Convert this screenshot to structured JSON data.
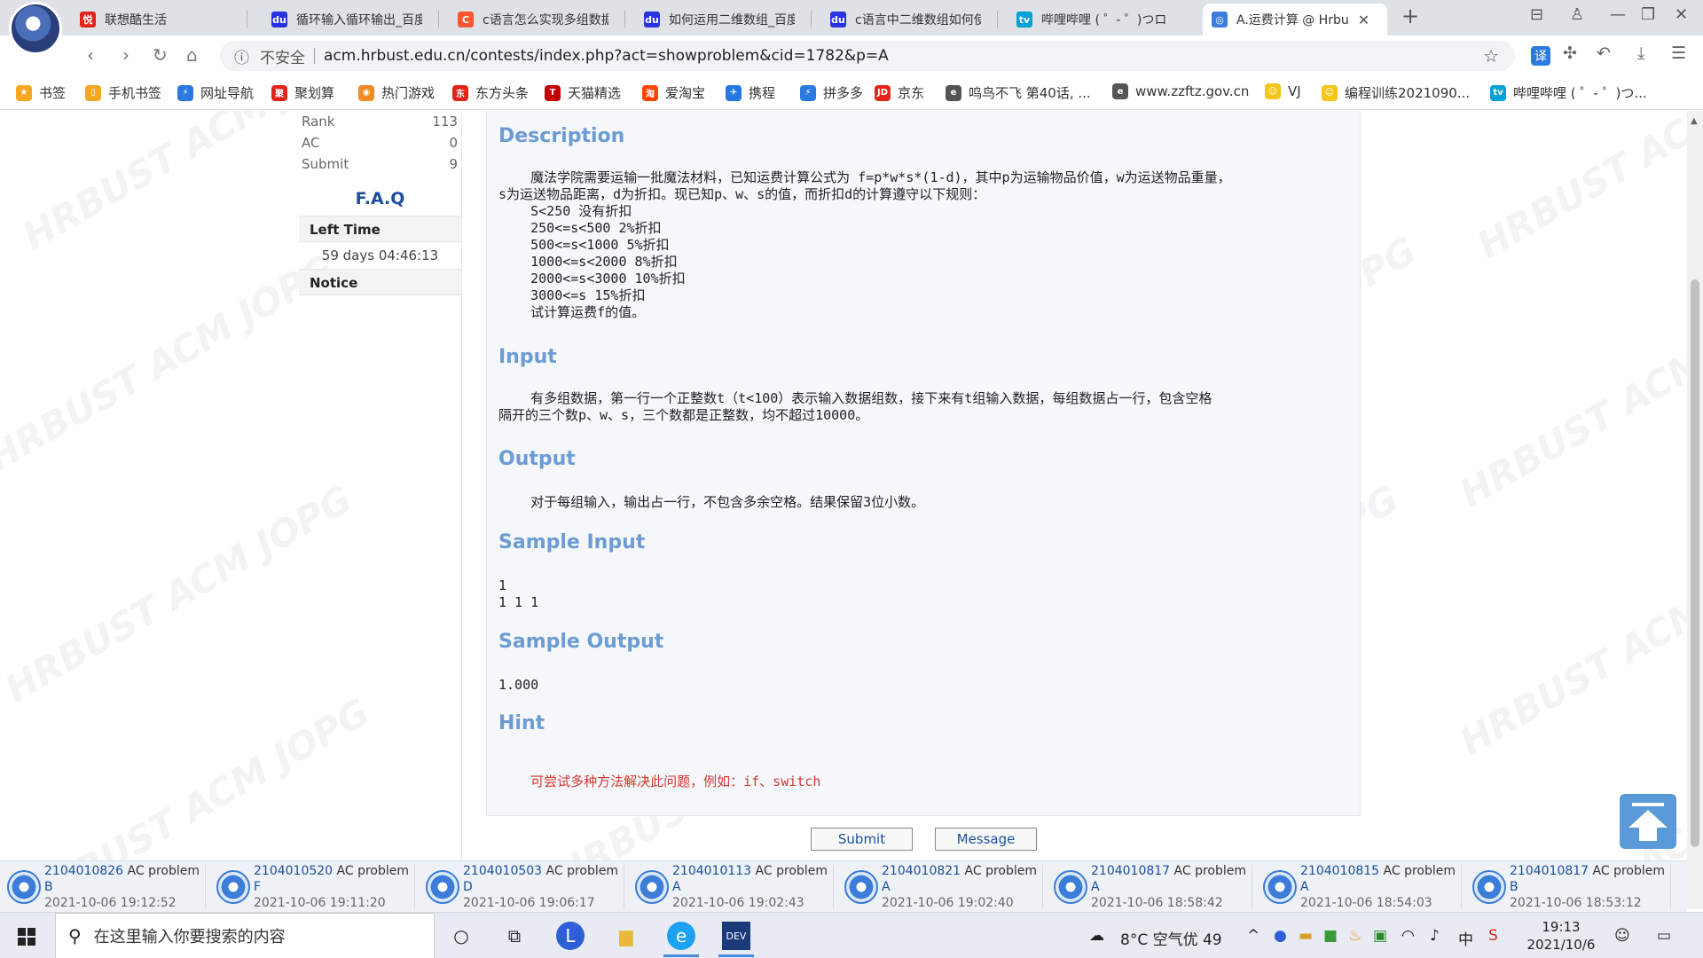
{
  "browser": {
    "tabs": [
      {
        "label": "联想酷生活",
        "fav_color": "#e2231a",
        "fav_glyph": "悦"
      },
      {
        "label": "循环输入循环输出_百度",
        "fav_color": "#2932e1",
        "fav_glyph": "du"
      },
      {
        "label": "c语言怎么实现多组数据",
        "fav_color": "#fc5531",
        "fav_glyph": "C"
      },
      {
        "label": "如何运用二维数组_百度",
        "fav_color": "#2932e1",
        "fav_glyph": "du"
      },
      {
        "label": "c语言中二维数组如何使",
        "fav_color": "#2932e1",
        "fav_glyph": "du"
      },
      {
        "label": "哔哩哔哩 ( ゜- ゜)つロ 干",
        "fav_color": "#00a1d6",
        "fav_glyph": "tv"
      },
      {
        "label": "A.运费计算 @ Hrbu",
        "fav_color": "#3b7dd8",
        "fav_glyph": "◎",
        "active": true
      }
    ],
    "address": {
      "insecure_label": "不安全",
      "url": "acm.hrbust.edu.cn/contests/index.php?act=showproblem&cid=1782&p=A"
    },
    "bookmarks": [
      {
        "label": "书签",
        "color": "#f5a623",
        "glyph": "★"
      },
      {
        "label": "手机书签",
        "color": "#f5a623",
        "glyph": "▯"
      },
      {
        "label": "网址导航",
        "color": "#2a7ae2",
        "glyph": "⚡"
      },
      {
        "label": "聚划算",
        "color": "#e2231a",
        "glyph": "聚"
      },
      {
        "label": "热门游戏",
        "color": "#f08a24",
        "glyph": "◉"
      },
      {
        "label": "东方头条",
        "color": "#e2231a",
        "glyph": "东"
      },
      {
        "label": "天猫精选",
        "color": "#c40000",
        "glyph": "T"
      },
      {
        "label": "爱淘宝",
        "color": "#ff4400",
        "glyph": "淘"
      },
      {
        "label": "携程",
        "color": "#2577e3",
        "glyph": "✈"
      },
      {
        "label": "拼多多",
        "color": "#2a7ae2",
        "glyph": "⚡"
      },
      {
        "label": "京东",
        "color": "#e1251b",
        "glyph": "JD"
      },
      {
        "label": "鸣鸟不飞 第40话, ...",
        "color": "#555555",
        "glyph": "e"
      },
      {
        "label": "www.zzftz.gov.cn",
        "color": "#555555",
        "glyph": "e"
      },
      {
        "label": "VJ",
        "color": "#f5c518",
        "glyph": "☺"
      },
      {
        "label": "编程训练2021090...",
        "color": "#f5c518",
        "glyph": "☺"
      },
      {
        "label": "哔哩哔哩 ( ゜- ゜)つ...",
        "color": "#00a1d6",
        "glyph": "tv"
      }
    ]
  },
  "sidebar": {
    "stats": [
      {
        "label": "Rank",
        "value": "113"
      },
      {
        "label": "AC",
        "value": "0"
      },
      {
        "label": "Submit",
        "value": "9"
      }
    ],
    "faq": "F.A.Q",
    "left_time_label": "Left Time",
    "left_time_value": "59 days 04:46:13",
    "notice_label": "Notice"
  },
  "problem": {
    "description_title": "Description",
    "description_body": "    魔法学院需要运输一批魔法材料，已知运费计算公式为 f=p*w*s*(1-d)，其中p为运输物品价值，w为运送物品重量，\ns为运送物品距离，d为折扣。现已知p、w、s的值，而折扣d的计算遵守以下规则：\n    S<250 没有折扣\n    250<=s<500 2%折扣\n    500<=s<1000 5%折扣\n    1000<=s<2000 8%折扣\n    2000<=s<3000 10%折扣\n    3000<=s 15%折扣\n    试计算运费f的值。",
    "input_title": "Input",
    "input_body": "    有多组数据，第一行一个正整数t（t<100）表示输入数据组数，接下来有t组输入数据，每组数据占一行，包含空格\n隔开的三个数p、w、s，三个数都是正整数，均不超过10000。",
    "output_title": "Output",
    "output_body": "    对于每组输入，输出占一行，不包含多余空格。结果保留3位小数。",
    "sample_input_title": "Sample Input",
    "sample_input_body": "1\n1 1 1",
    "sample_output_title": "Sample Output",
    "sample_output_body": "1.000",
    "hint_title": "Hint",
    "hint_body": "    可尝试多种方法解决此问题，例如：if、switch"
  },
  "buttons": {
    "submit": "Submit",
    "message": "Message"
  },
  "watermark_text": "HRBUST ACM JOPG",
  "ticker": [
    {
      "id": "2104010826",
      "status": "AC problem",
      "problem": "B",
      "time": "2021-10-06 19:12:52"
    },
    {
      "id": "2104010520",
      "status": "AC problem",
      "problem": "F",
      "time": "2021-10-06 19:11:20"
    },
    {
      "id": "2104010503",
      "status": "AC problem",
      "problem": "D",
      "time": "2021-10-06 19:06:17"
    },
    {
      "id": "2104010113",
      "status": "AC problem",
      "problem": "A",
      "time": "2021-10-06 19:02:43"
    },
    {
      "id": "2104010821",
      "status": "AC problem",
      "problem": "A",
      "time": "2021-10-06 19:02:40"
    },
    {
      "id": "2104010817",
      "status": "AC problem",
      "problem": "A",
      "time": "2021-10-06 18:58:42"
    },
    {
      "id": "2104010815",
      "status": "AC problem",
      "problem": "A",
      "time": "2021-10-06 18:54:03"
    },
    {
      "id": "2104010817",
      "status": "AC problem",
      "problem": "B",
      "time": "2021-10-06 18:53:12"
    }
  ],
  "taskbar": {
    "search_placeholder": "在这里输入你要搜索的内容",
    "weather": "8°C  空气优 49",
    "ime": "中",
    "time": "19:13",
    "date": "2021/10/6"
  }
}
